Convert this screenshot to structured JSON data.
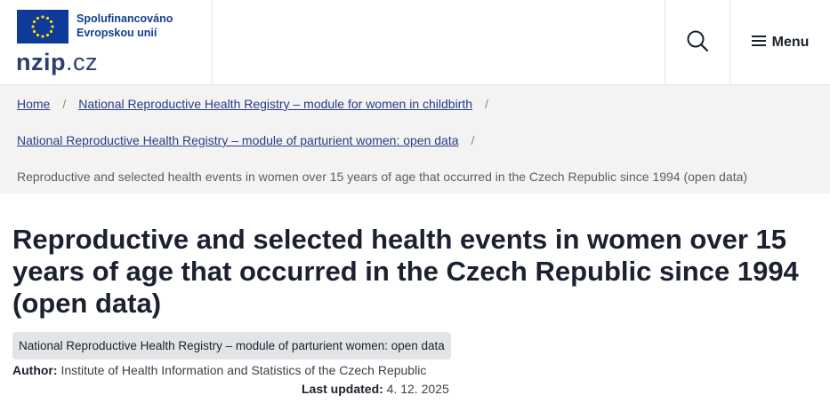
{
  "header": {
    "eu_text_line1": "Spolufinancováno",
    "eu_text_line2": "Evropskou unií",
    "logo_text": "nzip",
    "logo_domain": ".cz",
    "search_icon": "search-icon",
    "menu_icon": "hamburger-icon",
    "menu_label": "Menu",
    "brand_color": "#123f8c"
  },
  "breadcrumb": {
    "items": [
      {
        "label": "Home"
      },
      {
        "label": "National Reproductive Health Registry – module for women in childbirth"
      },
      {
        "label": "National Reproductive Health Registry – module of parturient women: open data"
      }
    ],
    "current": "Reproductive and selected health events in women over 15 years of age that occurred in the Czech Republic since 1994 (open data)",
    "separator": "/"
  },
  "main": {
    "title": "Reproductive and selected health events in women over 15 years of age that occurred in the Czech Republic since 1994 (open data)",
    "tag": "National Reproductive Health Registry – module of parturient women: open data",
    "author_label": "Author:",
    "author": "Institute of Health Information and Statistics of the Czech Republic",
    "updated_label": "Last updated:",
    "updated": "4. 12. 2025"
  }
}
